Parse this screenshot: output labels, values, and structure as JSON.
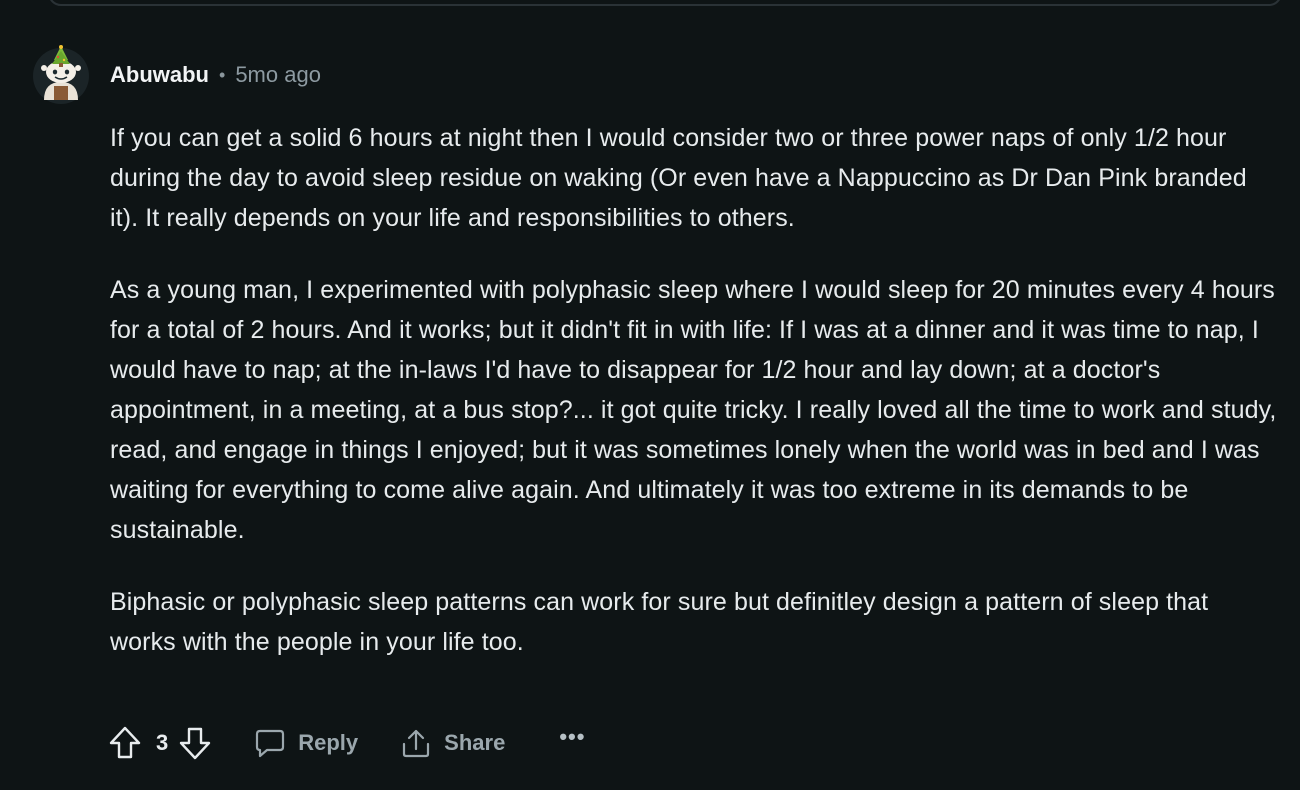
{
  "comment": {
    "author": "Abuwabu",
    "separator": "•",
    "timestamp": "5mo ago",
    "paragraphs": [
      "If you can get a solid 6 hours at night then I would consider two or three power naps of only 1/2 hour during the day to avoid sleep residue on waking (Or even have a Nappuccino as Dr Dan Pink branded it). It really depends on your life and responsibilities to others.",
      "As a young man, I experimented with polyphasic sleep where I would sleep for 20 minutes every 4 hours for a total of 2 hours. And it works; but it didn't fit in with life: If I was at a dinner and it was time to nap, I would have to nap; at the in-laws I'd have to disappear for 1/2 hour and lay down; at a doctor's appointment, in a meeting, at a bus stop?... it got quite tricky. I really loved all the time to work and study, read, and engage in things I enjoyed; but it was sometimes lonely when the world was in bed and I was waiting for everything to come alive again. And ultimately it was too extreme in its demands to be sustainable.",
      "Biphasic or polyphasic sleep patterns can work for sure but definitley design a pattern of sleep that works with the people in your life too."
    ],
    "score": "3"
  },
  "actions": {
    "reply_label": "Reply",
    "share_label": "Share",
    "more_label": "•••"
  },
  "icons": {
    "upvote": "upvote-arrow-icon",
    "downvote": "downvote-arrow-icon",
    "reply": "speech-bubble-icon",
    "share": "share-upload-icon",
    "more": "ellipsis-icon",
    "avatar": "snoo-avatar"
  },
  "colors": {
    "background": "#0e1415",
    "text": "#e7ebed",
    "muted": "#8d9aa1"
  }
}
